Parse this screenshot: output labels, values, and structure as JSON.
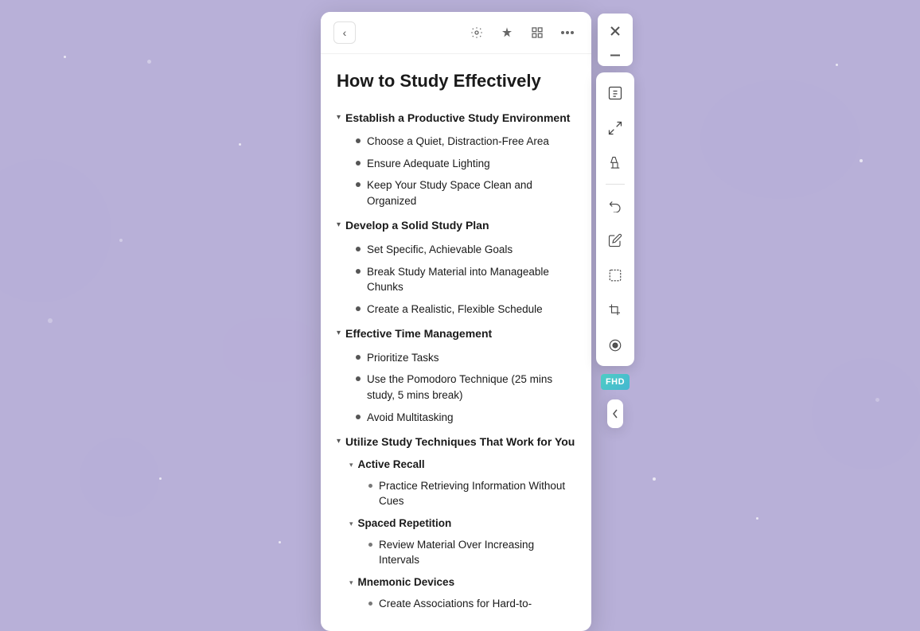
{
  "background": {
    "color": "#b8b0d8"
  },
  "panel": {
    "title": "How to Study Effectively",
    "sections": [
      {
        "id": "section-1",
        "label": "Establish a Productive Study Environment",
        "expanded": true,
        "items": [
          "Choose a Quiet, Distraction-Free Area",
          "Ensure Adequate Lighting",
          "Keep Your Study Space Clean and Organized"
        ]
      },
      {
        "id": "section-2",
        "label": "Develop a Solid Study Plan",
        "expanded": true,
        "items": [
          "Set Specific, Achievable Goals",
          "Break Study Material into Manageable Chunks",
          "Create a Realistic, Flexible Schedule"
        ]
      },
      {
        "id": "section-3",
        "label": "Effective Time Management",
        "expanded": true,
        "items": [
          "Prioritize Tasks",
          "Use the Pomodoro Technique (25 mins study, 5 mins break)",
          "Avoid Multitasking"
        ]
      },
      {
        "id": "section-4",
        "label": "Utilize Study Techniques That Work for You",
        "expanded": true,
        "nested": [
          {
            "id": "nested-1",
            "label": "Active Recall",
            "expanded": true,
            "items": [
              "Practice Retrieving Information Without Cues"
            ]
          },
          {
            "id": "nested-2",
            "label": "Spaced Repetition",
            "expanded": true,
            "items": [
              "Review Material Over Increasing Intervals"
            ]
          },
          {
            "id": "nested-3",
            "label": "Mnemonic Devices",
            "expanded": true,
            "items": [
              "Create Associations for Hard-to-"
            ]
          }
        ]
      }
    ]
  },
  "toolbar": {
    "back_icon": "‹",
    "icons": [
      "⚙",
      "✦",
      "⊞",
      "⋯"
    ],
    "tools": [
      "↩",
      "✎",
      "▣",
      "⌗",
      "◉"
    ],
    "close_icon": "✕",
    "minimize_icon": "—",
    "fhd_label": "FHD",
    "expand_icon": "◁"
  }
}
